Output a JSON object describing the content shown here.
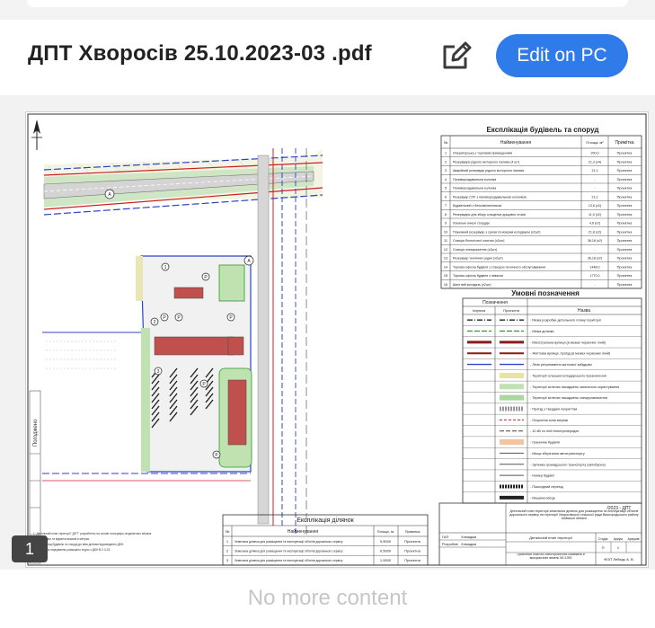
{
  "header": {
    "title": "ДПТ Хворосів 25.10.2023-03 .pdf",
    "edit_button": "Edit on PC",
    "edit_icon": "pencil-square-icon"
  },
  "viewer": {
    "page_number": "1",
    "footer_text": "No more content"
  },
  "drawing": {
    "buildings_table": {
      "title": "Експлікація будівель та споруд",
      "columns": [
        "№",
        "Найменування",
        "Площа, м²",
        "Примітка"
      ],
      "rows": [
        [
          "1",
          "Операторська з торговим приміщенням",
          "200,0",
          "Проектна"
        ],
        [
          "2",
          "Резервуари рідкого моторного палива (4 шт)",
          "21,3 (х4)",
          "Проектна"
        ],
        [
          "3",
          "Аварійний резервуар рідкого моторного палива",
          "21,1",
          "Проектна"
        ],
        [
          "4",
          "Паливороздавальна колонка",
          "-",
          "Проектна"
        ],
        [
          "5",
          "Паливороздавальна колонка",
          "-",
          "Проектна"
        ],
        [
          "6",
          "Резервуар СПГ з паливороздавальною колонкою",
          "21,2",
          "Проектна"
        ],
        [
          "7",
          "Будівельний з блоком/смітником",
          "13,6 (х2)",
          "Проектна"
        ],
        [
          "8",
          "Резервуари для збору очищених дощових стоків",
          "11,0 (х2)",
          "Проектна"
        ],
        [
          "9",
          "Локальні очисні споруди",
          "4,6 (х2)",
          "Проектна"
        ],
        [
          "10",
          "Пожежний резервуар з сухим та мокрим колодязем (х2шт)",
          "21,8 (х2)",
          "Проектна"
        ],
        [
          "11",
          "Станція біологічної очистки (х2шт)",
          "36,18 (х2)",
          "Проектна"
        ],
        [
          "12",
          "Станція знезараження (х2шт)",
          "-",
          "Проектна"
        ],
        [
          "13",
          "Резервуар технічних рідин (х2шт)",
          "36,18 (х2)",
          "Проектна"
        ],
        [
          "14",
          "Торгово-офісна будівля з станцією технічного обслуговування",
          "1448,0",
          "Проектна"
        ],
        [
          "15",
          "Торгово-офісна будівля з навісом",
          "1770,0",
          "Проектна"
        ],
        [
          "16",
          "Шахтний колодязь (х2шт)",
          "-",
          "Проектна"
        ]
      ]
    },
    "legend": {
      "title": "Умовні позначення",
      "columns": [
        "Позначення",
        "Назва"
      ],
      "sub_columns": [
        "Існуюча",
        "Проектна"
      ],
      "items": [
        "- Межа розробки детального плану території",
        "- Межа ділянки",
        "- Магістральна вулиця (в межах червоних ліній)",
        "- Житлова вулиця, проїзд (в межах червоних ліній)",
        "- Лінія регулювання житлової забудови",
        "- Території сільськогосподарського призначення",
        "- Території зелених насаджень загального користування",
        "- Території зелених насаджень спецпризначення",
        "- Проїзд з твердим покриттям",
        "- Охоронна зона мережі",
        "- 10 кВ та лінії електропередач",
        "- Гранична будівля",
        "- Місця зберігання автотранспорту",
        "- Зупинка громадського транспорту (автобусна)",
        "- Номер будівлі",
        "- Пішохідний перехід",
        "- Машино-місце"
      ]
    },
    "plots_table": {
      "title": "Експлікація ділянок",
      "columns": [
        "№",
        "Найменування",
        "Площа, га",
        "Примітка"
      ],
      "rows": [
        [
          "1",
          "Земельна ділянка для розміщення та експлуатації об'єктів дорожнього сервісу",
          "0,5000",
          "Проектна"
        ],
        [
          "2",
          "Земельна ділянка для розміщення та експлуатації об'єктів дорожнього сервісу",
          "0,5000",
          "Проектна"
        ],
        [
          "3",
          "Земельна ділянка для розміщення та експлуатації об'єктів дорожнього сервісу",
          "1,0000",
          "Проектна"
        ]
      ]
    },
    "title_block": {
      "code": "/2023 - ДПТ",
      "description": "Детальний план території земельних ділянок для розміщення та експлуатації об'єктів дорожнього сервісу на території Хворосівської сільської ради Вишгородського району Київської області",
      "sheet_name": "Детальний план території",
      "stage": "П",
      "sheets": "1",
      "plan_label": "Проектний план на схемі проектних обмежень в використанні земель М1:1000",
      "org": "ФОП Лебедь А. В.",
      "roles": [
        "ГАП",
        "Розробив"
      ],
      "names": [
        "Хомаджи",
        "Хомаджи"
      ],
      "stage_headers": [
        "Стадія",
        "Аркуш",
        "Аркушів"
      ]
    },
    "side_label": "Погоджено",
    "notes": [
      "1. Детальний план території \"ДПТ\" розроблено на основі топографо-геодезичних зйомок.",
      "2. Усі розміри та відмітки вказані в метрах.",
      "3. Відстані від будівель та споруд до меж ділянки відповідають ДБН.",
      "4. Місця для паркування розміщено згідно з ДБН В.2.3-15."
    ],
    "map_labels": [
      "А",
      "А",
      "1",
      "2",
      "3",
      "Р",
      "Р",
      "Р",
      "Р",
      "Р",
      "Р"
    ]
  }
}
